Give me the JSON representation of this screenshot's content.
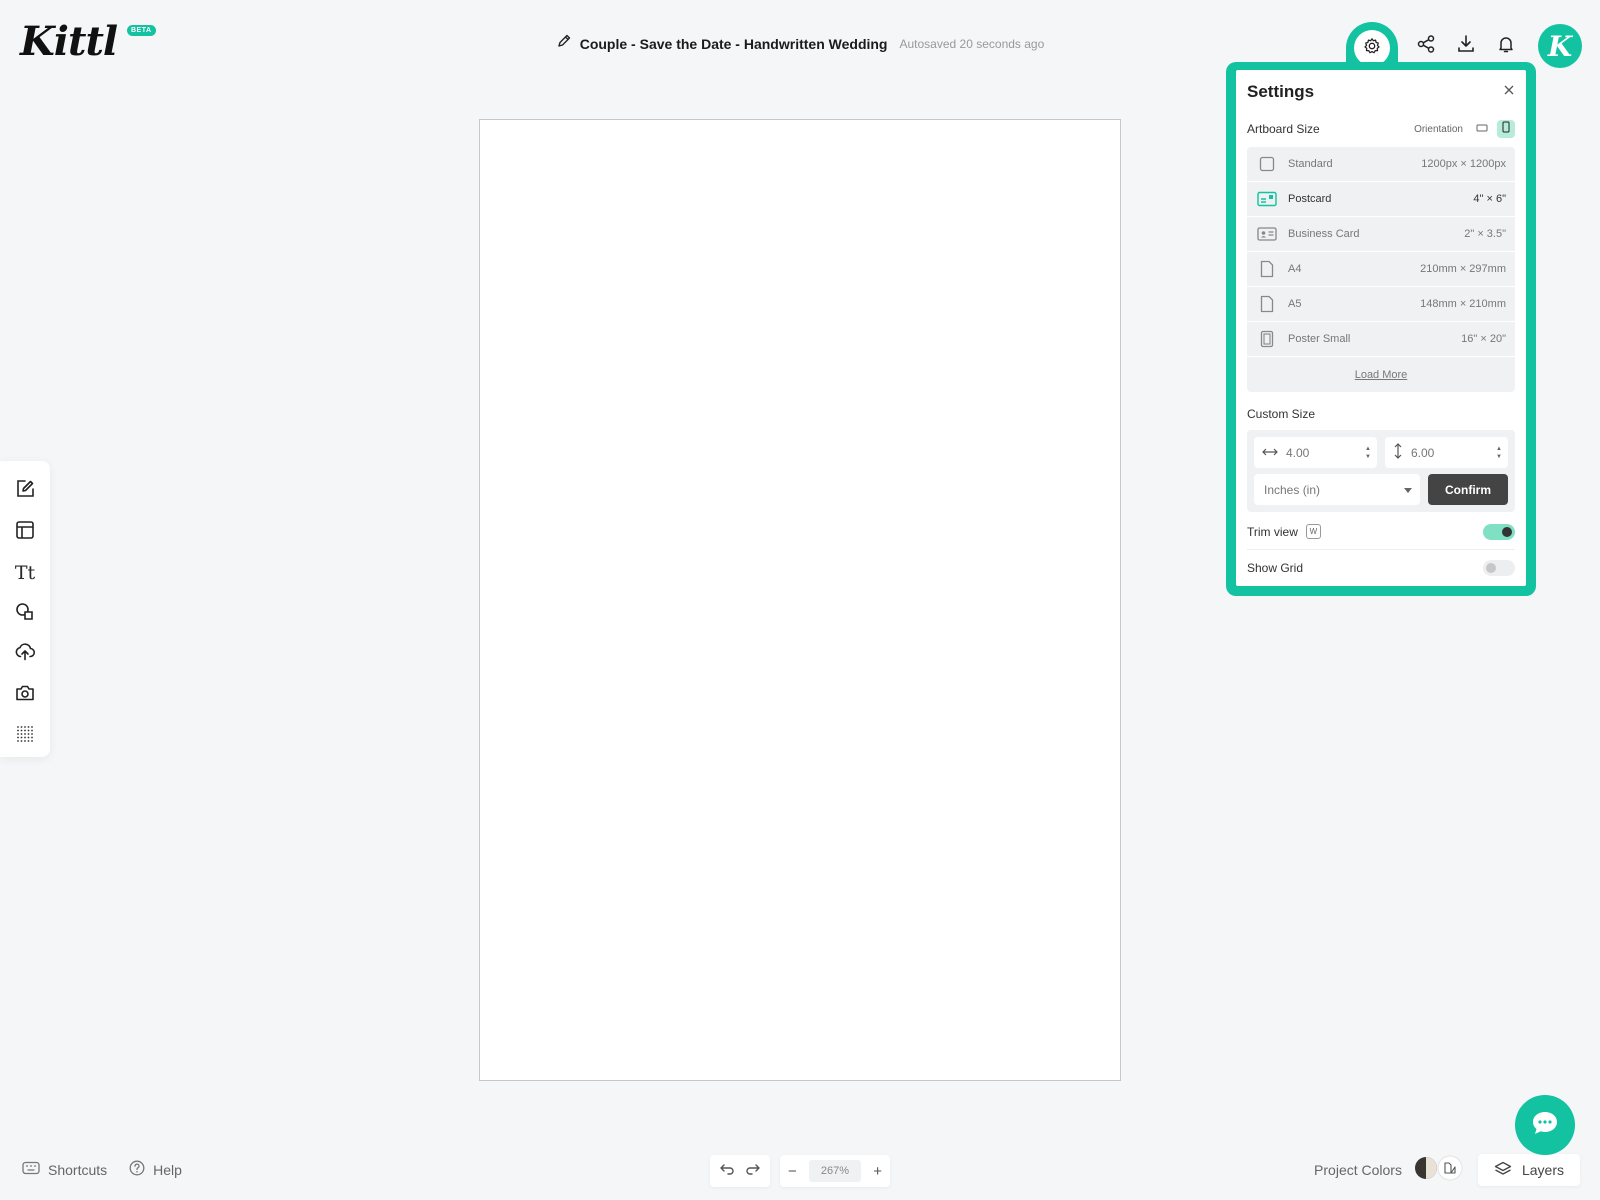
{
  "header": {
    "logo": "Kittl",
    "beta_badge": "BETA",
    "document_title": "Couple - Save the Date - Handwritten Wedding",
    "autosave_status": "Autosaved 20 seconds ago",
    "avatar_letter": "K",
    "actions": [
      "settings-icon",
      "share-icon",
      "download-icon",
      "bell-icon"
    ]
  },
  "toolbar": {
    "tools": [
      "edit-icon",
      "templates-icon",
      "text-icon",
      "shapes-icon",
      "upload-icon",
      "camera-icon",
      "grid-icon"
    ],
    "text_tool_label": "Tt"
  },
  "settings": {
    "title": "Settings",
    "artboard_size_label": "Artboard Size",
    "orientation_label": "Orientation",
    "orientation_selected": "portrait",
    "sizes": [
      {
        "label": "Standard",
        "dims": "1200px × 1200px",
        "icon": "square-icon"
      },
      {
        "label": "Postcard",
        "dims": "4\" × 6\"",
        "icon": "postcard-icon",
        "selected": true
      },
      {
        "label": "Business Card",
        "dims": "2\" × 3.5\"",
        "icon": "business-card-icon"
      },
      {
        "label": "A4",
        "dims": "210mm × 297mm",
        "icon": "page-icon"
      },
      {
        "label": "A5",
        "dims": "148mm × 210mm",
        "icon": "page-icon"
      },
      {
        "label": "Poster Small",
        "dims": "16\" × 20\"",
        "icon": "poster-icon"
      }
    ],
    "load_more": "Load More",
    "custom_size_label": "Custom Size",
    "width_value": "4.00",
    "height_value": "6.00",
    "unit": "Inches (in)",
    "confirm_label": "Confirm",
    "trim_view_label": "Trim view",
    "trim_view_shortcut": "W",
    "trim_view_on": true,
    "show_grid_label": "Show Grid",
    "show_grid_on": false
  },
  "bottom": {
    "shortcuts_label": "Shortcuts",
    "help_label": "Help",
    "zoom_minus": "−",
    "zoom_level": "267%",
    "zoom_plus": "+",
    "project_colors_label": "Project Colors",
    "layers_label": "Layers"
  },
  "colors": {
    "accent": "#12c2a0",
    "background": "#f5f6f8",
    "confirm_button": "#444444"
  }
}
